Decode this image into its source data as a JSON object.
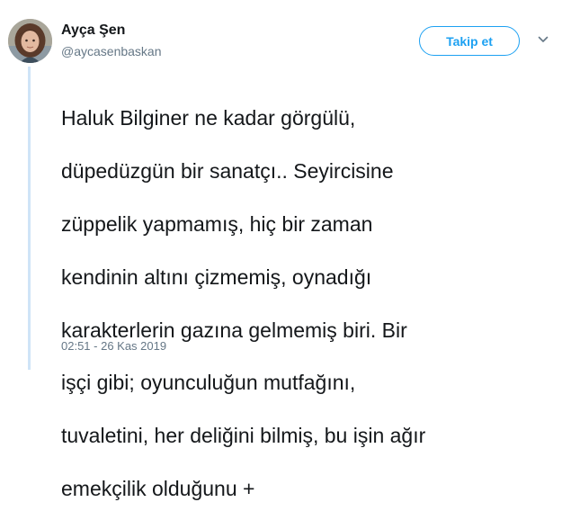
{
  "author": {
    "name": "Ayça Şen",
    "handle": "@aycasenbaskan",
    "avatar_icon": "profile-photo"
  },
  "follow_button": {
    "label": "Takip et"
  },
  "menu": {
    "icon": "chevron-down-icon"
  },
  "tweet": {
    "lines": [
      "Haluk Bilginer ne kadar görgülü,",
      "düpedüzgün bir sanatçı.. Seyircisine",
      "züppelik yapmamış, hiç bir zaman",
      "kendinin altını çizmemiş, oynadığı",
      "karakterlerin gazına gelmemiş biri. Bir",
      "işçi gibi; oyunculuğun mutfağını,",
      "tuvaletini, her deliğini bilmiş, bu işin ağır",
      "emekçilik olduğunu +"
    ],
    "timestamp": "02:51 - 26 Kas 2019"
  },
  "colors": {
    "accent": "#1da1f2",
    "secondary_text": "#657786",
    "thread_line": "#cfe4f7"
  }
}
